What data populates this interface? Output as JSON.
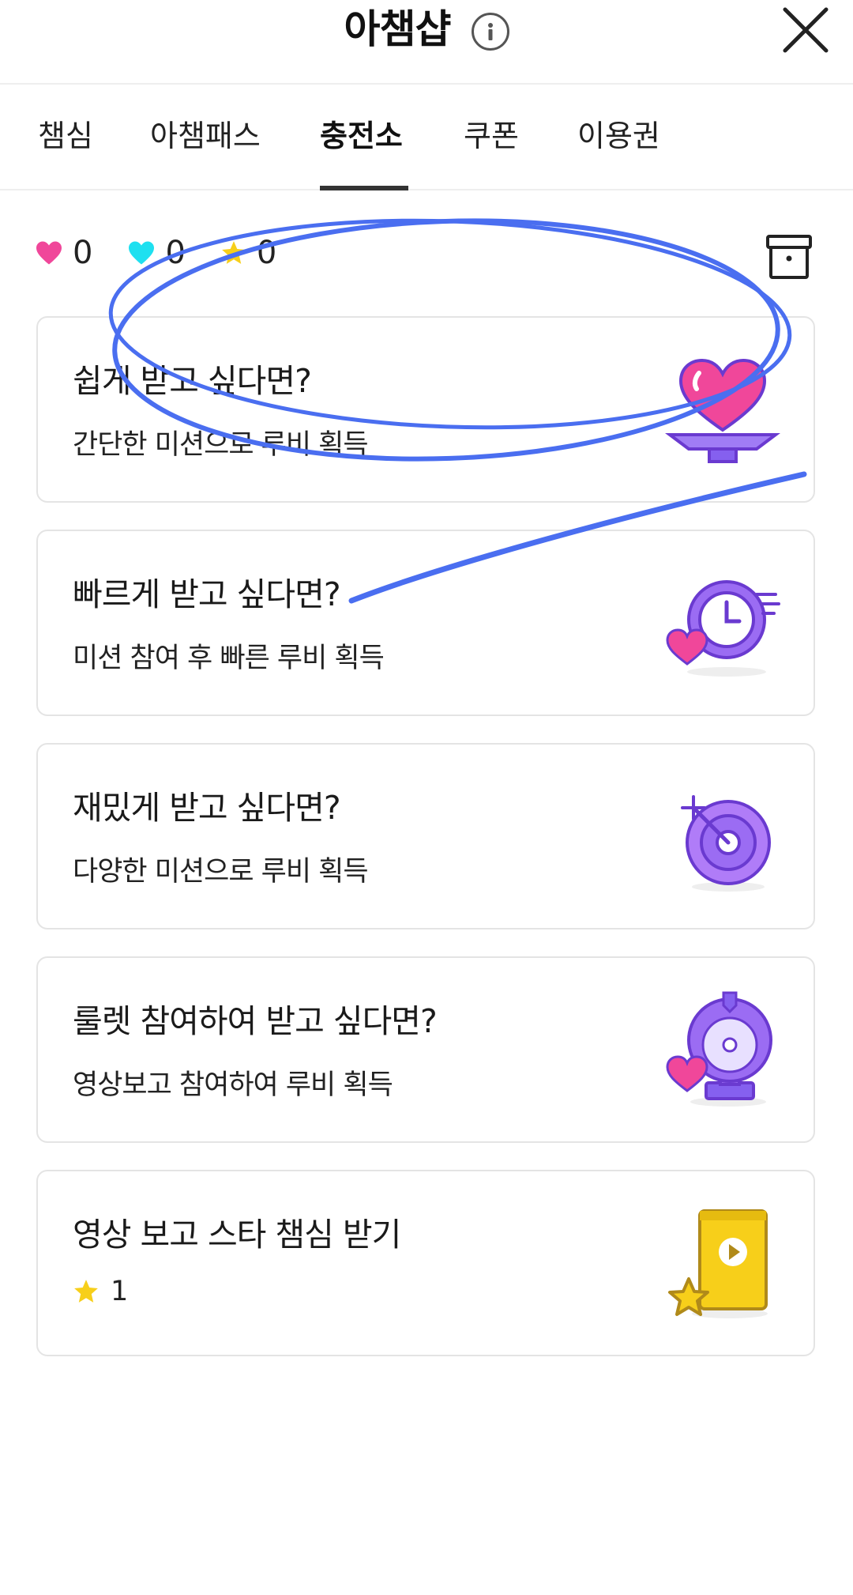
{
  "header": {
    "title": "아챔샵"
  },
  "tabs": [
    {
      "label": "챔심"
    },
    {
      "label": "아챔패스"
    },
    {
      "label": "충전소"
    },
    {
      "label": "쿠폰"
    },
    {
      "label": "이용권"
    }
  ],
  "active_tab": "충전소",
  "balances": [
    {
      "icon": "pink-heart-icon",
      "color": "#f0479a",
      "value": "0"
    },
    {
      "icon": "cyan-heart-icon",
      "color": "#1ee0f0",
      "value": "0"
    },
    {
      "icon": "star-icon",
      "color": "#f7cf1a",
      "value": "0"
    }
  ],
  "cards": [
    {
      "title": "쉽게 받고 싶다면?",
      "subtitle": "간단한 미션으로 루비 획득",
      "icon": "heart-on-plate-icon"
    },
    {
      "title": "빠르게 받고 싶다면?",
      "subtitle": "미션 참여 후 빠른 루비 획득",
      "icon": "fast-clock-heart-icon"
    },
    {
      "title": "재밌게 받고 싶다면?",
      "subtitle": "다양한 미션으로 루비 획득",
      "icon": "target-icon"
    },
    {
      "title": "룰렛 참여하여 받고 싶다면?",
      "subtitle": "영상보고 참여하여 루비 획득",
      "icon": "roulette-heart-icon"
    },
    {
      "title": "영상 보고 스타 챔심 받기",
      "reward": "1",
      "icon": "video-phone-star-icon"
    }
  ],
  "colors": {
    "accent_purple": "#7b5cf0",
    "heart_pink": "#f0479a",
    "star_yellow": "#f7cf1a",
    "annotation_blue": "#4a6ef0"
  }
}
